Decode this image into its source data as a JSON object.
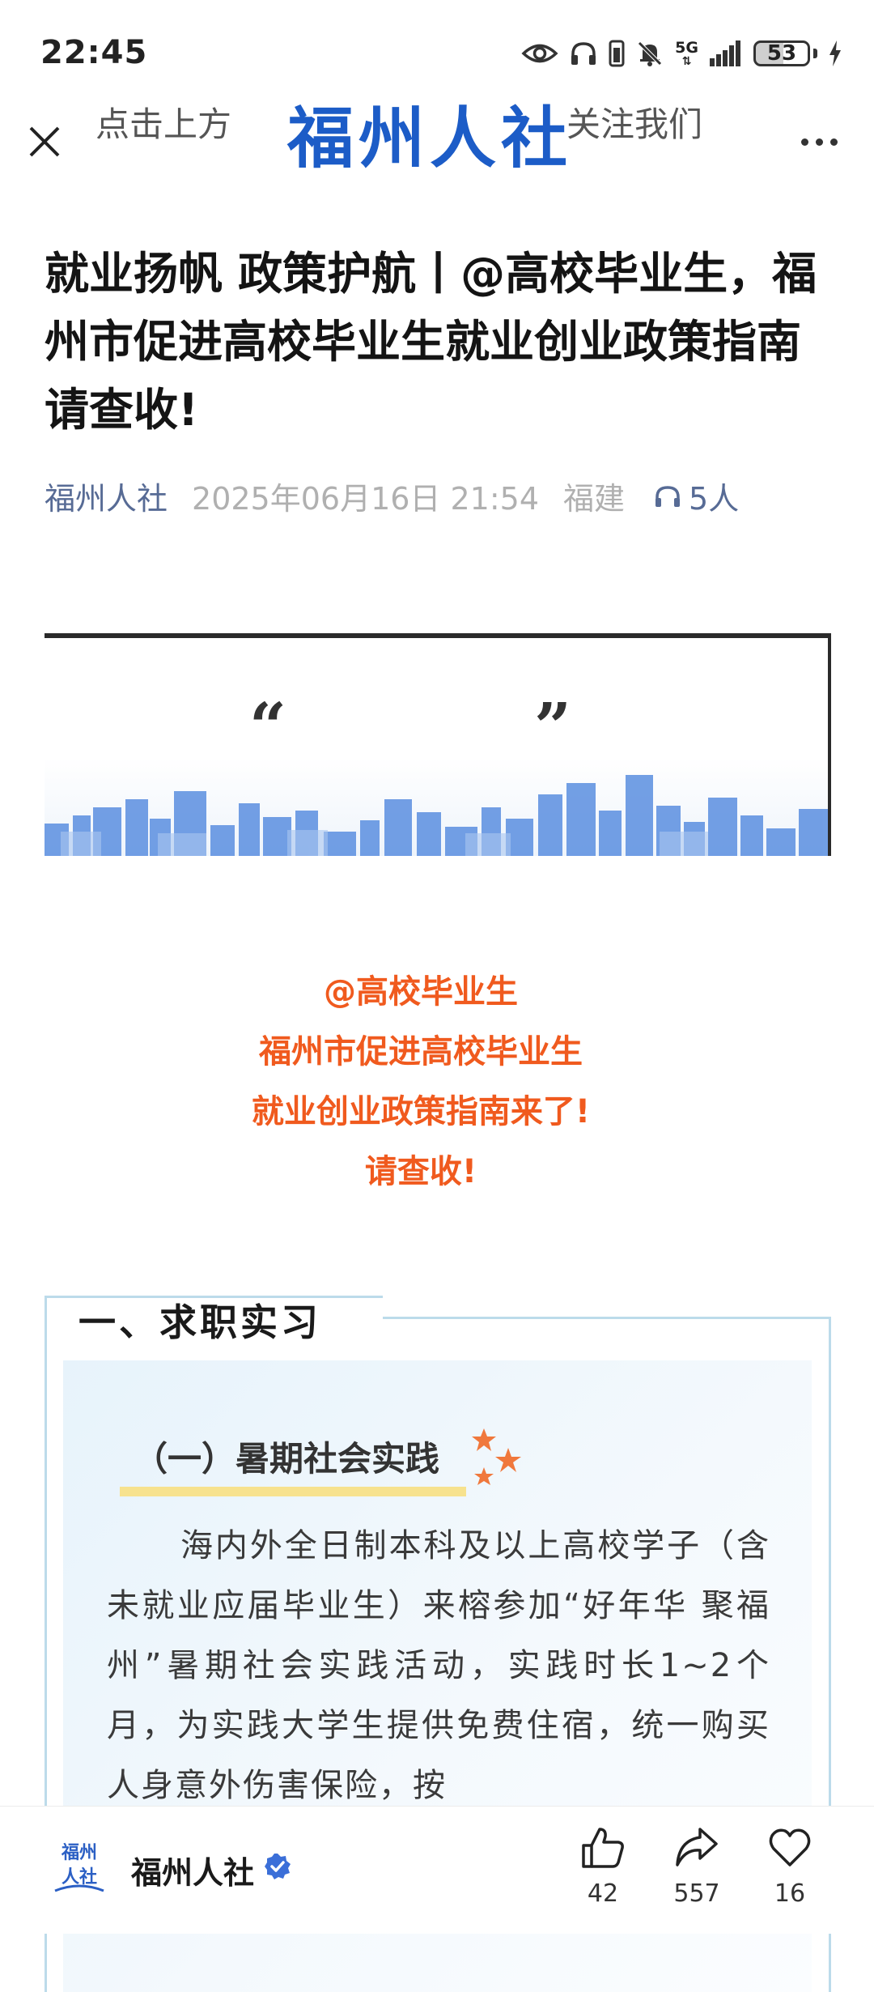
{
  "status_bar": {
    "time": "22:45",
    "network": "5G",
    "battery": "53",
    "icons": [
      "eye-icon",
      "headphones-icon",
      "vibrate-icon",
      "mute-bell-icon",
      "signal-icon",
      "battery-icon",
      "charging-icon"
    ]
  },
  "nav": {
    "close_icon": "close-icon",
    "more_icon": "more-icon"
  },
  "article": {
    "title": "就业扬帆 政策护航丨@高校毕业生，福州市促进高校毕业生就业创业政策指南请查收!",
    "author": "福州人社",
    "date": "2025年06月16日 21:54",
    "location": "福建",
    "listeners": "5人"
  },
  "banner": {
    "left_text": "点击上方",
    "open_quote": "“",
    "main_text": "福州人社",
    "close_quote": "”",
    "right_text": "关注我们"
  },
  "intro": {
    "lines": [
      "@高校毕业生",
      "福州市促进高校毕业生",
      "就业创业政策指南来了!",
      "请查收!"
    ],
    "color": "#f05a1e"
  },
  "section": {
    "heading": "一、求职实习",
    "subheading": "（一）暑期社会实践",
    "body": "海内外全日制本科及以上高校学子（含未就业应届毕业生）来榕参加“好年华 聚福州”暑期社会实践活动，实践时长1~2个月，为实践大学生提供免费住宿，统一购买人身意外伤害保险，按"
  },
  "bottom_bar": {
    "account_name": "福州人社",
    "avatar_text": "福州人社",
    "likes": "42",
    "shares": "557",
    "favorites": "16",
    "accent": "#3b6fd8"
  }
}
